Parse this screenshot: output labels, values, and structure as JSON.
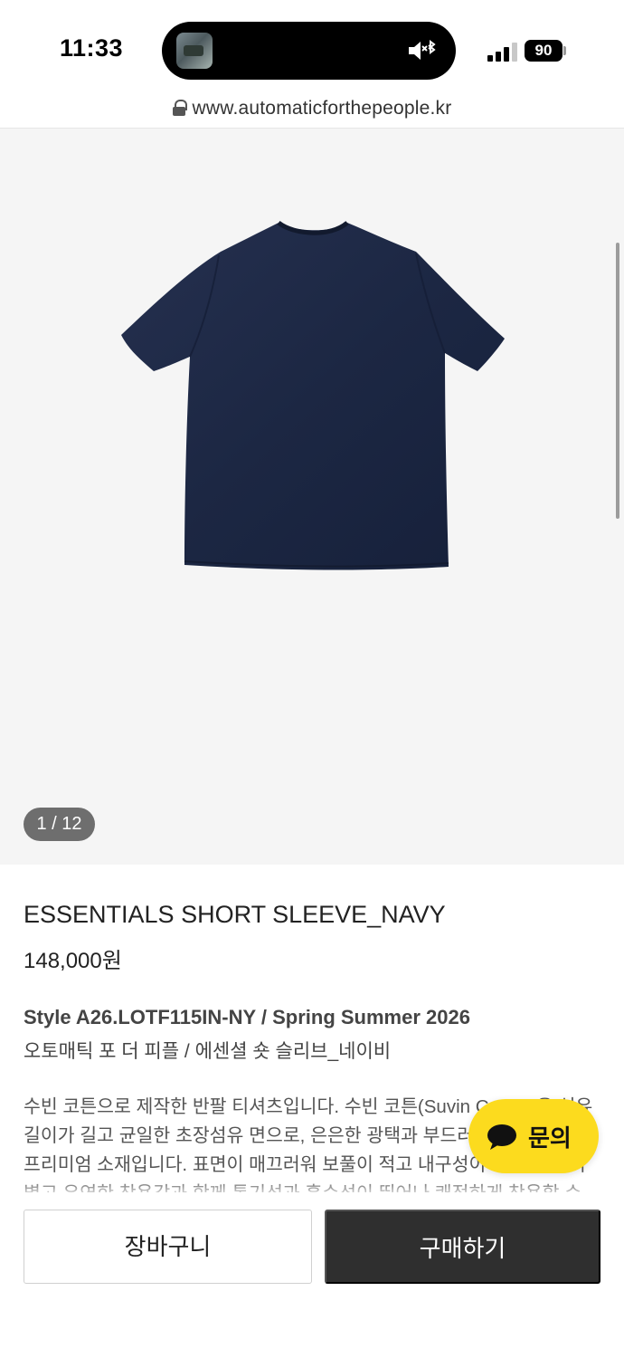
{
  "status_bar": {
    "time": "11:33",
    "battery": "90",
    "icons": [
      "now-playing-thumbnail",
      "mute-icon",
      "bluetooth-icon",
      "signal-icon",
      "battery-icon"
    ]
  },
  "browser": {
    "url": "www.automaticforthepeople.kr",
    "lock_icon": "lock-icon"
  },
  "gallery": {
    "page_indicator": "1 / 12",
    "image_alt": "navy short sleeve t-shirt"
  },
  "product": {
    "name": "ESSENTIALS SHORT SLEEVE_NAVY",
    "price": "148,000원",
    "style_line": "Style A26.LOTF115IN-NY / Spring Summer 2026",
    "korean_name": "오토매틱 포 더 피플 / 에센셜 숏 슬리브_네이비",
    "description": "수빈 코튼으로 제작한 반팔 티셔츠입니다. 수빈 코튼(Suvin Cotton)은 섬유 길이가 길고 균일한 초장섬유 면으로, 은은한 광택과 부드러운 촉감을 지닌 프리미엄 소재입니다. 표면이 매끄러워 보풀이 적고 내구성이 뛰어나며, 가볍고 유연한 착용감과 함께 통기성과 흡수성이 뛰어나 쾌적하게 착용할 수 있습니다."
  },
  "inquiry": {
    "label": "문의",
    "icon": "chat-bubble-icon",
    "color": "#fcdb1e"
  },
  "actions": {
    "cart_label": "장바구니",
    "buy_label": "구매하기"
  },
  "colors": {
    "product_navy": "#1c2743",
    "buy_button": "#2f2f2f",
    "gallery_bg": "#f5f5f5"
  }
}
